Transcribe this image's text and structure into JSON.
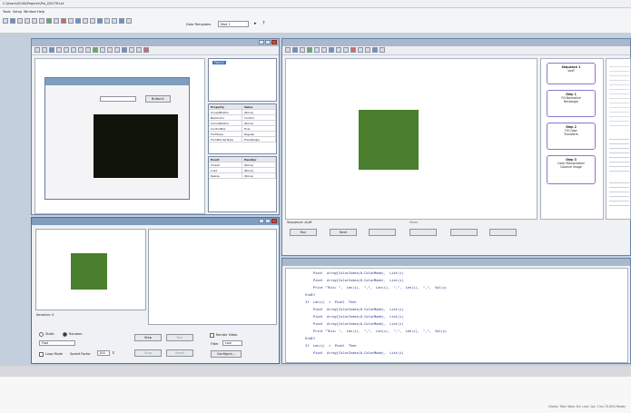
{
  "app": {
    "title": "C:\\Users\\SCHA\\Projects\\Pro_DOCTR.txt",
    "menu": [
      "Tools",
      "Setup",
      "Window",
      "Help"
    ],
    "toolbar_combo_label": "Data Templates",
    "toolbar_combo_value": "Mod 1"
  },
  "designer": {
    "form_button": "Button1",
    "tree_item": "Form1",
    "props_header": [
      "Property",
      "Value"
    ],
    "props": [
      [
        "AcceptButton",
        "(None)"
      ],
      [
        "BackColor",
        "Control"
      ],
      [
        "CancelButton",
        "(None)"
      ],
      [
        "ControlBox",
        "True"
      ],
      [
        "FontStyle",
        "Regular"
      ],
      [
        "FormBorderStyle",
        "FixedSingle"
      ]
    ],
    "events_header": [
      "Event",
      "Handler"
    ],
    "events": [
      [
        "Closed",
        "(None)"
      ],
      [
        "Load",
        "(None)"
      ],
      [
        "Resize",
        "(None)"
      ]
    ]
  },
  "run": {
    "status": "Iteration: 0",
    "radio1": "Static",
    "radio2": "Random",
    "combo_value": "Fast",
    "check_loop": "Loop Mode",
    "speed_label": "Speed Factor",
    "speed_value": "100",
    "btn_step": "Step",
    "btn_run": "Run",
    "btn_stop": "Stop",
    "btn_reset": "Reset",
    "check_render": "Render Video",
    "filter_label": "Filter",
    "filter_value": "Low",
    "btn_configure": "Configure..."
  },
  "preview": {
    "caption": "Sequence: stuff",
    "btn_run": "Run",
    "btn_next": "Next",
    "section_label": "Mode"
  },
  "flow": {
    "nodes": [
      {
        "title": "Sequence 1",
        "sub": "stuff"
      },
      {
        "title": "Step 1",
        "sub": "Fill Normalize",
        "sub2": "Rectangle"
      },
      {
        "title": "Step 2",
        "sub": "Fill Color",
        "sub2": "Transform"
      },
      {
        "title": "Step 3",
        "sub": "Color Manipulation",
        "sub2": "Colorize image"
      }
    ]
  },
  "code": {
    "lines": [
      "            Pixel  Array[ColorIndex(0.ColorMode),  List(i)",
      "            Pixel  Array[ColorIndex(0.ColorMode),  List(i)",
      "            Print \"This: \",  Len(i),  \",\",  Len(i),  \",\",  Len(i),  \",\",  Val(x)",
      "        EndIf",
      "        If  Len(i)  >  Pixel  Then",
      "            Pixel  Array[ColorIndex(0.ColorMode),  List(i)",
      "            Pixel  Array[ColorIndex(0.ColorMode),  List(i)",
      "            Pixel  Array[ColorIndex(0.ColorMode),  List(i)",
      "            Print \"This: \",  Len(i),  \",\",  Len(i),  \",\",  Len(i),  \",\",  Val(x)",
      "        EndIf",
      "        If  Len(i)  >  Pixel  Then",
      "            Pixel  Array[ColorIndex(0.ColorMode),  List(i)"
    ]
  },
  "statusbar": {
    "text": "Charts:  Title:  Note:  Err:  Line:  Col: 1  Ins  70.00%  Ready"
  },
  "colors": {
    "green_square": "#4a7f2d",
    "dark_box": "#10150c",
    "accent": "#7f9dbf"
  }
}
